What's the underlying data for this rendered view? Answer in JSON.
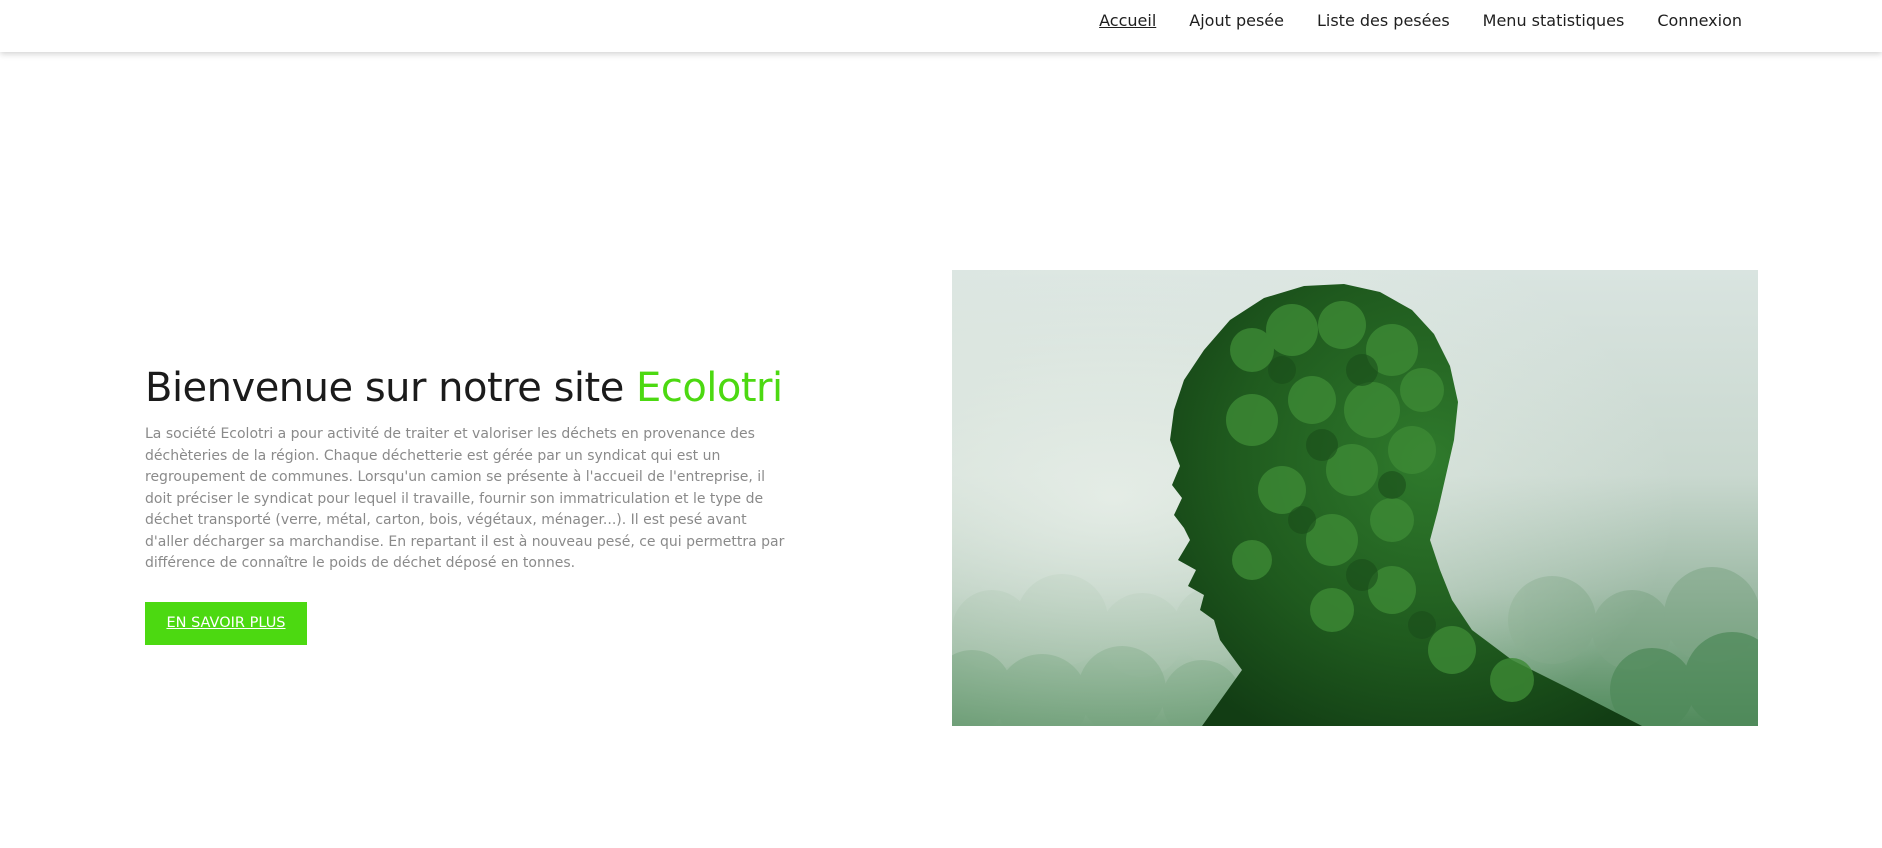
{
  "nav": {
    "items": [
      {
        "label": "Accueil",
        "active": true
      },
      {
        "label": "Ajout pesée",
        "active": false
      },
      {
        "label": "Liste des pesées",
        "active": false
      },
      {
        "label": "Menu statistiques",
        "active": false
      },
      {
        "label": "Connexion",
        "active": false
      }
    ]
  },
  "hero": {
    "title_prefix": "Bienvenue sur notre site ",
    "title_brand": "Ecolotri",
    "description": "La société Ecolotri a pour activité de traiter et valoriser les déchets en provenance des déchèteries de la région. Chaque déchetterie est gérée par un syndicat qui est un regroupement de communes. Lorsqu'un camion se présente à l'accueil de l'entreprise, il doit préciser le syndicat pour lequel il travaille, fournir son immatriculation et le type de déchet transporté (verre, métal, carton, bois, végétaux, ménager...). Il est pesé avant d'aller décharger sa marchandise. En repartant il est à nouveau pesé, ce qui permettra par différence de connaître le poids de déchet déposé en tonnes.",
    "cta_label": "EN SAVOIR PLUS",
    "image_subject": "forest-head-silhouette"
  },
  "colors": {
    "accent": "#4cd911",
    "text": "#1b1b1b",
    "muted": "#8a8a8a"
  }
}
